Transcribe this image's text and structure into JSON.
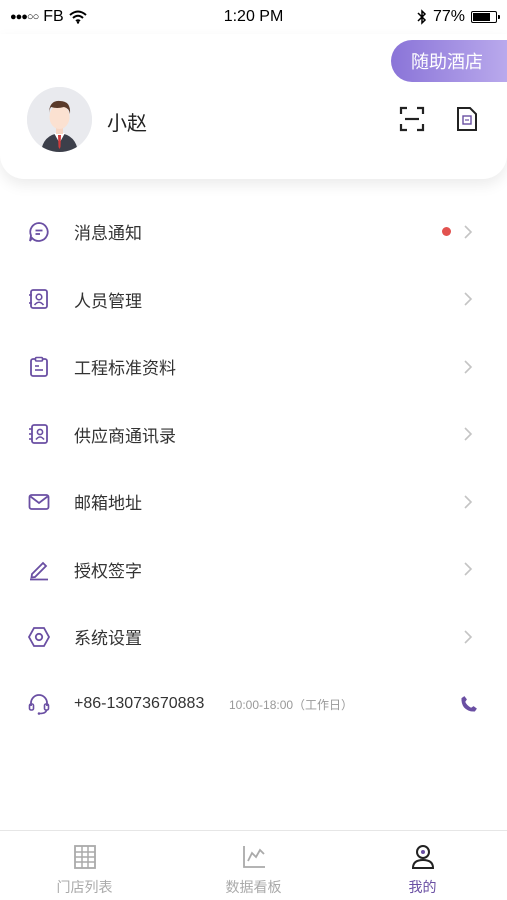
{
  "status_bar": {
    "carrier": "FB",
    "time": "1:20 PM",
    "battery": "77%",
    "battery_level": 0.77
  },
  "header": {
    "hotel_label": "随助酒店",
    "username": "小赵"
  },
  "menu": {
    "items": [
      {
        "label": "消息通知",
        "icon": "message-icon",
        "has_badge": true
      },
      {
        "label": "人员管理",
        "icon": "personnel-icon"
      },
      {
        "label": "工程标准资料",
        "icon": "clipboard-icon"
      },
      {
        "label": "供应商通讯录",
        "icon": "contacts-icon"
      },
      {
        "label": "邮箱地址",
        "icon": "mail-icon"
      },
      {
        "label": "授权签字",
        "icon": "pen-icon"
      },
      {
        "label": "系统设置",
        "icon": "settings-icon"
      }
    ],
    "contact": {
      "phone": "+86-13073670883",
      "hours": "10:00-18:00（工作日）",
      "icon": "headset-icon"
    }
  },
  "tabbar": {
    "tabs": [
      {
        "label": "门店列表",
        "icon": "building-icon",
        "active": false
      },
      {
        "label": "数据看板",
        "icon": "chart-icon",
        "active": false
      },
      {
        "label": "我的",
        "icon": "profile-icon",
        "active": true
      }
    ]
  },
  "colors": {
    "accent": "#6a4fa3",
    "pill_start": "#8a74d8",
    "pill_end": "#b9a9ec",
    "badge": "#e2524f"
  }
}
